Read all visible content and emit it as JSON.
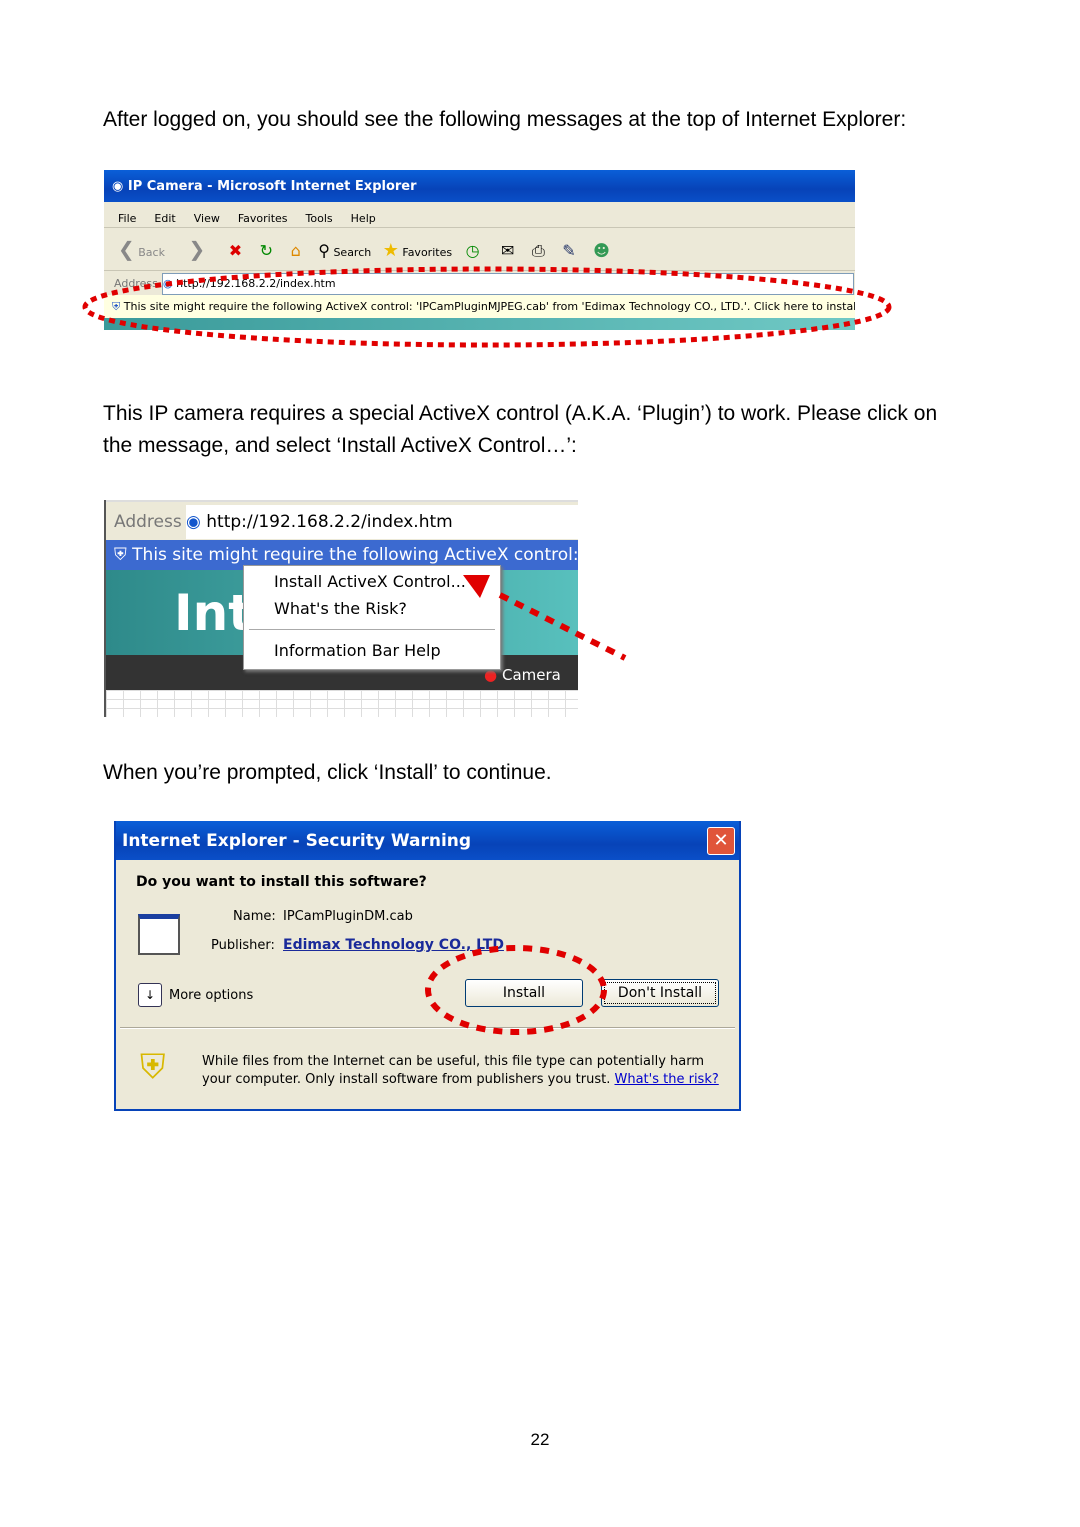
{
  "intro_text": "After logged on, you should see the following messages at the top of Internet Explorer:",
  "shot1": {
    "window_title": "IP Camera - Microsoft Internet Explorer",
    "menu": [
      "File",
      "Edit",
      "View",
      "Favorites",
      "Tools",
      "Help"
    ],
    "toolbar": {
      "back": "Back",
      "search": "Search",
      "favorites": "Favorites"
    },
    "address_label": "Address",
    "url": "http://192.168.2.2/index.htm",
    "info_bar": "This site might require the following ActiveX control: 'IPCamPluginMJPEG.cab' from 'Edimax Technology CO., LTD.'. Click here to install..."
  },
  "para2_line1": "This IP camera requires a special ActiveX control (A.K.A. ‘Plugin’) to work. Please click on",
  "para2_line2": "the message, and select ‘Install ActiveX Control…’:",
  "shot2": {
    "address_label": "Address",
    "url": "http://192.168.2.2/index.htm",
    "info_bar": "This site might require the following ActiveX control: 'IPC",
    "page_heading": "Inte",
    "camera_label": "Camera",
    "context_menu": [
      "Install ActiveX Control...",
      "What's the Risk?",
      "Information Bar Help"
    ]
  },
  "para3": "When you’re prompted, click ‘Install’ to continue.",
  "dialog": {
    "title": "Internet Explorer - Security Warning",
    "question": "Do you want to install this software?",
    "name_label": "Name:",
    "name_value": "IPCamPluginDM.cab",
    "publisher_label": "Publisher:",
    "publisher_value": "Edimax Technology CO., LTD",
    "more_options": "More options",
    "install": "Install",
    "dont_install": "Don't Install",
    "warning": "While files from the Internet can be useful, this file type can potentially harm your computer. Only install software from publishers you trust.",
    "risk_link": "What's the risk?"
  },
  "page_number": "22",
  "colors": {
    "highlight": "#e00000",
    "xp_blue": "#0743b8",
    "dialog_bg": "#ece9d8",
    "info_yellow": "#ffffe1"
  }
}
